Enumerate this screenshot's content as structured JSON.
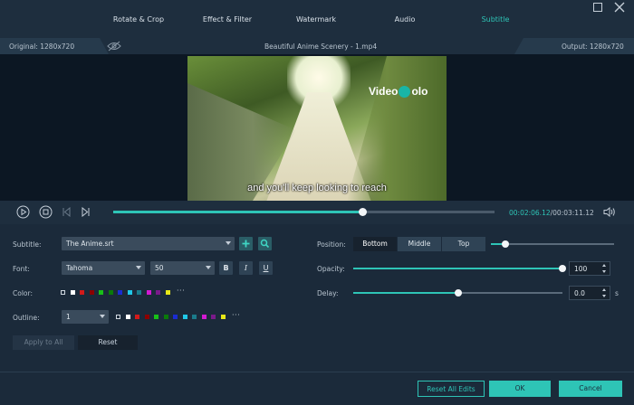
{
  "tabs": [
    {
      "label": "Rotate & Crop"
    },
    {
      "label": "Effect & Filter"
    },
    {
      "label": "Watermark"
    },
    {
      "label": "Audio"
    },
    {
      "label": "Subtitle",
      "active": true
    }
  ],
  "info": {
    "original": "Original: 1280x720",
    "filename": "Beautiful Anime Scenery - 1.mp4",
    "output": "Output: 1280x720"
  },
  "video": {
    "logo_text_1": "Video",
    "logo_text_2": "olo",
    "subtitle_line": "and you'll keep looking to reach"
  },
  "playback": {
    "current_time": "00:02:06.12",
    "separator": "/",
    "total_time": "00:03:11.12",
    "progress": 0.653
  },
  "subtitle": {
    "label": "Subtitle:",
    "file": "The Anime.srt",
    "add_icon": "plus-icon",
    "search_icon": "search-icon"
  },
  "font": {
    "label": "Font:",
    "family": "Tahoma",
    "size": "50",
    "bold": "B",
    "italic": "I",
    "underline": "U"
  },
  "color": {
    "label": "Color:",
    "swatches": [
      "empty",
      "#ffffff",
      "#d21a1a",
      "#8b0000",
      "#18c018",
      "#0a7a0a",
      "#1a2bd2",
      "#20c8e8",
      "#1a7a8a",
      "#d21ad2",
      "#7a1a8a",
      "#e8e818"
    ],
    "more": "···"
  },
  "outline": {
    "label": "Outline:",
    "width": "1",
    "swatches": [
      "empty",
      "#ffffff",
      "#d21a1a",
      "#8b0000",
      "#18c018",
      "#0a7a0a",
      "#1a2bd2",
      "#20c8e8",
      "#1a7a8a",
      "#d21ad2",
      "#7a1a8a",
      "#e8e818"
    ],
    "more": "···"
  },
  "buttons": {
    "apply_all": "Apply to All",
    "reset": "Reset"
  },
  "position": {
    "label": "Position:",
    "options": [
      "Bottom",
      "Middle",
      "Top"
    ],
    "selected": "Bottom",
    "offset": 0.12
  },
  "opacity": {
    "label": "Opacity:",
    "value": "100",
    "level": 1.0
  },
  "delay": {
    "label": "Delay:",
    "value": "0.0",
    "unit": "s",
    "level": 0.5
  },
  "footer": {
    "reset_all": "Reset All Edits",
    "ok": "OK",
    "cancel": "Cancel"
  },
  "colors": {
    "accent": "#2ec4b6",
    "background": "#1b2a3a",
    "primary_button": "#2ec4b6"
  }
}
